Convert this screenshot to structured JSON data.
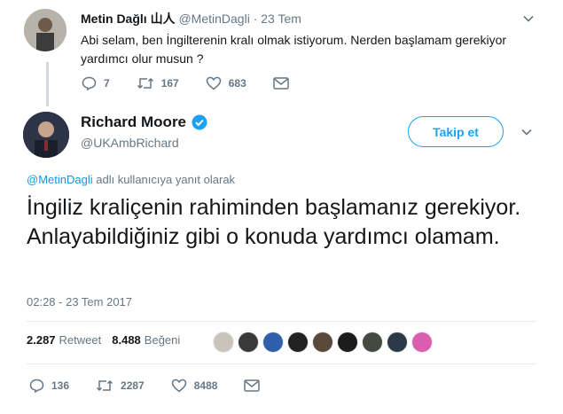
{
  "reply_tweet": {
    "name": "Metin Dağlı",
    "name_suffix": "山人",
    "handle": "@MetinDagli",
    "dot": "·",
    "date": "23 Tem",
    "text": "Abi selam, ben İngilterenin kralı olmak istiyorum. Nerden başlamam gerekiyor yardımcı olur musun ?",
    "actions": {
      "replies": "7",
      "retweets": "167",
      "likes": "683"
    }
  },
  "main_tweet": {
    "name": "Richard Moore",
    "handle": "@UKAmbRichard",
    "follow_label": "Takip et",
    "reply_to_handle": "@MetinDagli",
    "reply_to_suffix": " adlı kullanıcıya yanıt olarak",
    "text": "İngiliz kraliçenin rahiminden başlamanız gerekiyor.  Anlayabildiğiniz gibi o konuda yardımcı olamam.",
    "timestamp": "02:28 - 23 Tem 2017",
    "retweet_count": "2.287",
    "retweet_label": "Retweet",
    "like_count": "8.488",
    "like_label": "Beğeni",
    "actions": {
      "replies": "136",
      "retweets": "2287",
      "likes": "8488"
    }
  },
  "colors": {
    "accent": "#1da1f2",
    "secondary_text": "#657786",
    "primary_text": "#14171a"
  },
  "likers": [
    "#c9c3bb",
    "#3a3a3a",
    "#2f5fa8",
    "#222222",
    "#5a4a3a",
    "#1c1c1c",
    "#444a40",
    "#2c3a48",
    "#d95fae"
  ]
}
